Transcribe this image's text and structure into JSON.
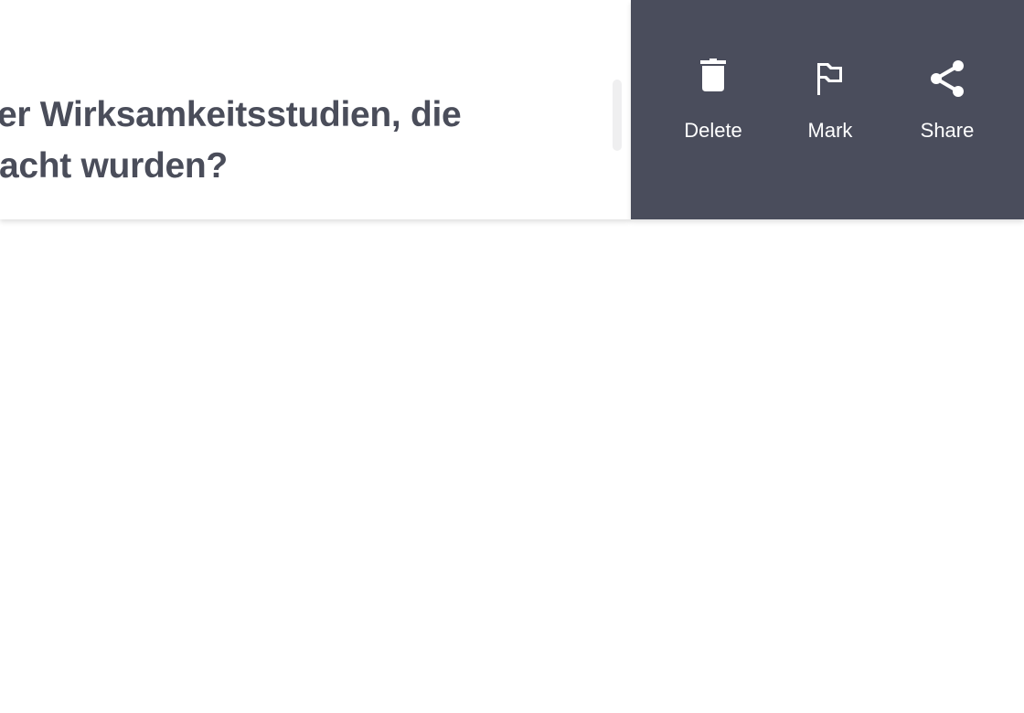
{
  "card": {
    "question_line1": "er Wirksamkeitsstudien, die",
    "question_line2": "acht wurden?"
  },
  "actions": [
    {
      "label": "Delete",
      "icon": "trash-icon"
    },
    {
      "label": "Mark",
      "icon": "flag-icon"
    },
    {
      "label": "Share",
      "icon": "share-icon"
    }
  ],
  "colors": {
    "panel": "#4a4d5c",
    "text": "#4a4d5a"
  }
}
